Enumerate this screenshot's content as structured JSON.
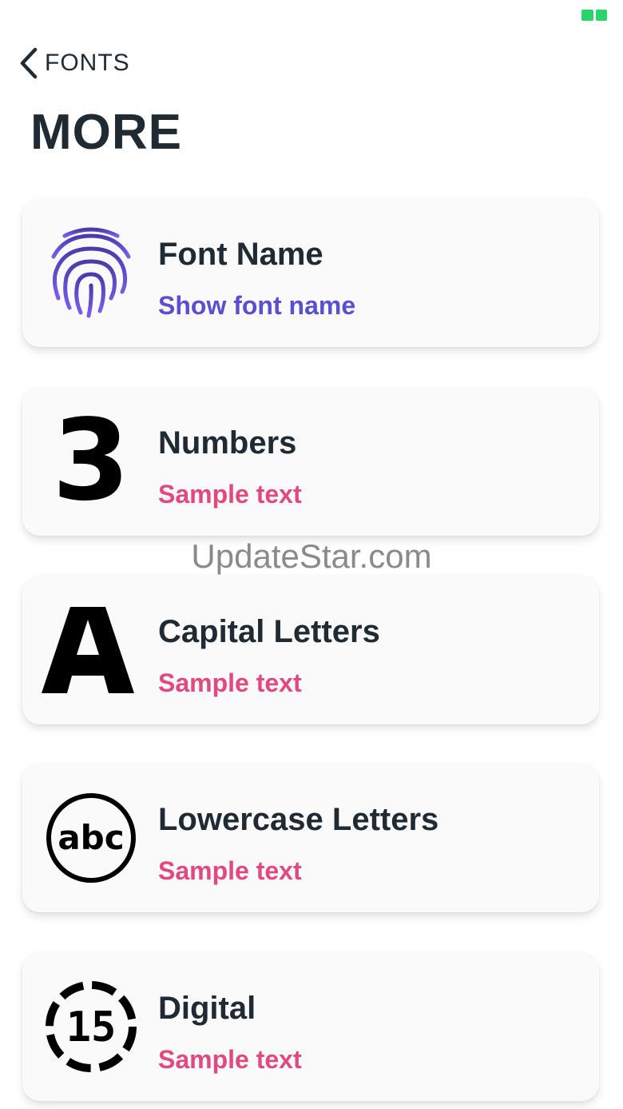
{
  "nav": {
    "back_label": "FONTS"
  },
  "page": {
    "title": "MORE"
  },
  "watermark": "UpdateStar.com",
  "cards": [
    {
      "title": "Font Name",
      "subtitle": "Show font name",
      "subtitle_color": "#5a4ed1",
      "icon": "fingerprint-icon"
    },
    {
      "title": "Numbers",
      "subtitle": "Sample text",
      "subtitle_color": "#e04a7c",
      "icon": "number-three-icon",
      "glyph": "3"
    },
    {
      "title": "Capital Letters",
      "subtitle": "Sample text",
      "subtitle_color": "#e04a7c",
      "icon": "capital-a-icon",
      "glyph": "A"
    },
    {
      "title": "Lowercase Letters",
      "subtitle": "Sample text",
      "subtitle_color": "#e04a7c",
      "icon": "abc-circle-icon",
      "glyph": "abc"
    },
    {
      "title": "Digital",
      "subtitle": "Sample text",
      "subtitle_color": "#e04a7c",
      "icon": "digital-15-icon",
      "glyph": "15"
    }
  ]
}
